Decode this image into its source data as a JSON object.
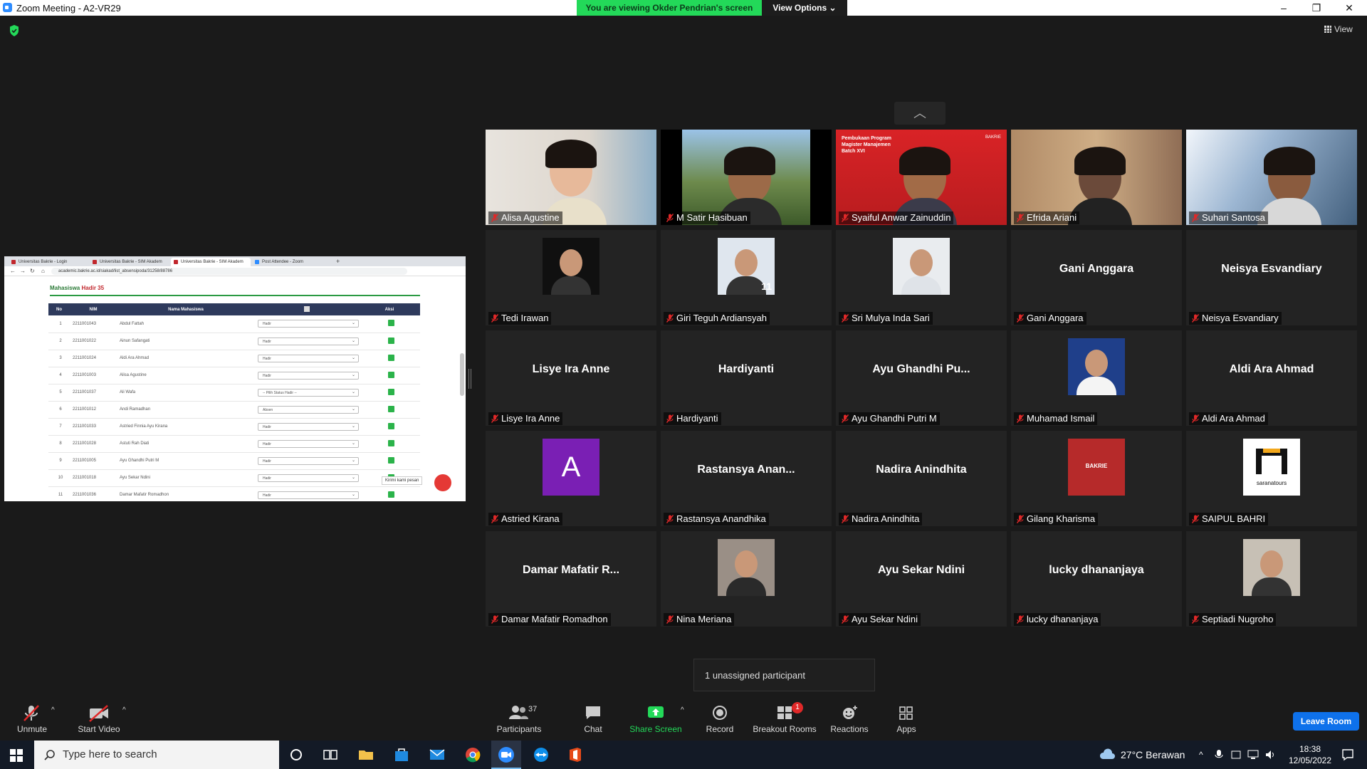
{
  "window": {
    "title": "Zoom Meeting - A2-VR29",
    "viewing_banner": "You are viewing Okder Pendrian's screen",
    "view_options": "View Options",
    "view_button": "View"
  },
  "shared_screen": {
    "tabs": [
      "Universitas Bakrie - Login",
      "Universitas Bakrie - SIM Akadem",
      "Universitas Bakrie - SIM Akadem",
      "Post Attendee - Zoom"
    ],
    "new_tab": "+",
    "url": "academic.bakrie.ac.id/siakad/list_absensipoda/31258/88786",
    "heading": "Mahasiswa",
    "heading_red": "Hadir 35",
    "columns": [
      "No",
      "NIM",
      "Nama Mahasiswa",
      "",
      "Aksi"
    ],
    "rows": [
      [
        "1",
        "2211001043",
        "Abdul Fattah",
        "Hadir"
      ],
      [
        "2",
        "2211001022",
        "Ainun Safangati",
        "Hadir"
      ],
      [
        "3",
        "2211001024",
        "Aldi Ara Ahmad",
        "Hadir"
      ],
      [
        "4",
        "2211001003",
        "Alisa Agustine",
        "Hadir"
      ],
      [
        "5",
        "2211001037",
        "Ali Wafa",
        "-- Pilih Status Hadir --"
      ],
      [
        "6",
        "2211001012",
        "Andi Ramadhan",
        "Absen"
      ],
      [
        "7",
        "2211001033",
        "Astried Finnia Ayu Kirana",
        "Hadir"
      ],
      [
        "8",
        "2211001028",
        "Astuti Rah Diati",
        "Hadir"
      ],
      [
        "9",
        "2211001005",
        "Ayu Ghandhi Putri M",
        "Hadir"
      ],
      [
        "10",
        "2211001018",
        "Ayu Sekar Ndini",
        "Hadir"
      ],
      [
        "11",
        "2211001036",
        "Damar Mafatir Romadhon",
        "Hadir"
      ]
    ],
    "chat_tooltip": "Kirimi kami pesan"
  },
  "participants": [
    {
      "name": "Alisa Agustine",
      "big": "",
      "kind": "video"
    },
    {
      "name": "M Satir Hasibuan",
      "big": "",
      "kind": "video"
    },
    {
      "name": "Syaiful Anwar Zainuddin",
      "big": "",
      "kind": "video"
    },
    {
      "name": "Efrida Ariani",
      "big": "",
      "kind": "video"
    },
    {
      "name": "Suhari Santosa",
      "big": "",
      "kind": "video"
    },
    {
      "name": "Tedi Irawan",
      "big": "",
      "kind": "photo"
    },
    {
      "name": "Giri Teguh Ardiansyah",
      "big": "",
      "kind": "photo"
    },
    {
      "name": "Sri Mulya Inda Sari",
      "big": "",
      "kind": "photo"
    },
    {
      "name": "Gani Anggara",
      "big": "Gani Anggara",
      "kind": "text"
    },
    {
      "name": "Neisya Esvandiary",
      "big": "Neisya Esvandiary",
      "kind": "text"
    },
    {
      "name": "Lisye Ira Anne",
      "big": "Lisye Ira Anne",
      "kind": "text"
    },
    {
      "name": "Hardiyanti",
      "big": "Hardiyanti",
      "kind": "text"
    },
    {
      "name": "Ayu Ghandhi Putri M",
      "big": "Ayu Ghandhi Pu...",
      "kind": "text"
    },
    {
      "name": "Muhamad Ismail",
      "big": "",
      "kind": "photo"
    },
    {
      "name": "Aldi Ara Ahmad",
      "big": "Aldi Ara Ahmad",
      "kind": "text"
    },
    {
      "name": "Astried Kirana",
      "big": "A",
      "kind": "letter"
    },
    {
      "name": "Rastansya Anandhika",
      "big": "Rastansya Anan...",
      "kind": "text"
    },
    {
      "name": "Nadira Anindhita",
      "big": "Nadira Anindhita",
      "kind": "text"
    },
    {
      "name": "Gilang Kharisma",
      "big": "",
      "kind": "photo"
    },
    {
      "name": "SAIPUL BAHRI",
      "big": "",
      "kind": "logo"
    },
    {
      "name": "Damar Mafatir Romadhon",
      "big": "Damar Mafatir R...",
      "kind": "text"
    },
    {
      "name": "Nina Meriana",
      "big": "",
      "kind": "photo"
    },
    {
      "name": "Ayu Sekar Ndini",
      "big": "Ayu Sekar Ndini",
      "kind": "text"
    },
    {
      "name": "lucky dhananjaya",
      "big": "lucky dhananjaya",
      "kind": "text"
    },
    {
      "name": "Septiadi Nugroho",
      "big": "",
      "kind": "photo"
    }
  ],
  "thumb_texts": {
    "syaiful_slide": "Pembukaan Program Magister Manajemen Batch XVI",
    "bakrie": "BAKRIE",
    "giri_badge": "11",
    "sarana": "saranatours"
  },
  "unassigned": "1 unassigned participant",
  "toolbar": {
    "unmute": "Unmute",
    "start_video": "Start Video",
    "participants": "Participants",
    "participant_count": "37",
    "chat": "Chat",
    "share_screen": "Share Screen",
    "record": "Record",
    "breakout_rooms": "Breakout Rooms",
    "breakout_badge": "1",
    "reactions": "Reactions",
    "apps": "Apps",
    "leave": "Leave Room"
  },
  "taskbar": {
    "search_placeholder": "Type here to search",
    "weather": "27°C  Berawan",
    "time": "18:38",
    "date": "12/05/2022"
  },
  "colors": {
    "zoom_blue": "#0e71eb",
    "viewing_green": "#23d959",
    "muted_red": "#e02828"
  }
}
